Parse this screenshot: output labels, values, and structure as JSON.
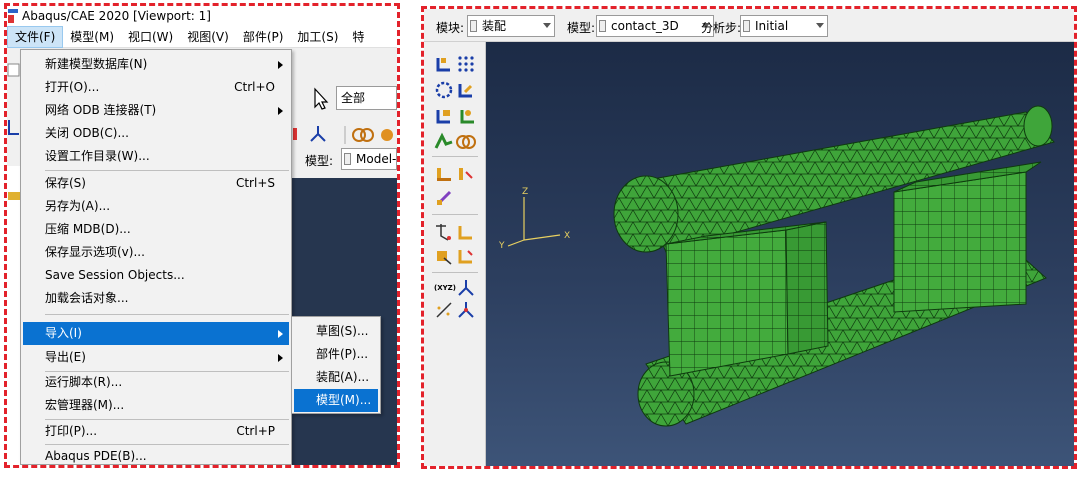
{
  "left": {
    "window_title": "Abaqus/CAE 2020 [Viewport: 1]",
    "menubar": [
      "文件(F)",
      "模型(M)",
      "视口(W)",
      "视图(V)",
      "部件(P)",
      "加工(S)",
      "特"
    ],
    "file_menu": [
      {
        "label": "新建模型数据库(N)",
        "shortcut": "",
        "submenu": true
      },
      {
        "label": "打开(O)...",
        "shortcut": "Ctrl+O",
        "submenu": false
      },
      {
        "label": "网络 ODB 连接器(T)",
        "shortcut": "",
        "submenu": true
      },
      {
        "label": "关闭 ODB(C)...",
        "shortcut": "",
        "submenu": false
      },
      {
        "label": "设置工作目录(W)...",
        "shortcut": "",
        "submenu": false
      },
      {
        "label": "保存(S)",
        "shortcut": "Ctrl+S",
        "submenu": false
      },
      {
        "label": "另存为(A)...",
        "shortcut": "",
        "submenu": false
      },
      {
        "label": "压缩 MDB(D)...",
        "shortcut": "",
        "submenu": false
      },
      {
        "label": "保存显示选项(v)...",
        "shortcut": "",
        "submenu": false
      },
      {
        "label": "Save Session Objects...",
        "shortcut": "",
        "submenu": false
      },
      {
        "label": "加载会话对象...",
        "shortcut": "",
        "submenu": false
      },
      {
        "label": "导入(I)",
        "shortcut": "",
        "submenu": true
      },
      {
        "label": "导出(E)",
        "shortcut": "",
        "submenu": true
      },
      {
        "label": "运行脚本(R)...",
        "shortcut": "",
        "submenu": false
      },
      {
        "label": "宏管理器(M)...",
        "shortcut": "",
        "submenu": false
      },
      {
        "label": "打印(P)...",
        "shortcut": "Ctrl+P",
        "submenu": false
      },
      {
        "label": "Abaqus PDE(B)...",
        "shortcut": "",
        "submenu": false
      }
    ],
    "import_submenu": [
      "草图(S)...",
      "部件(P)...",
      "装配(A)...",
      "模型(M)..."
    ],
    "selection_filter": "全部",
    "model_label": "模型:",
    "model_value": "Model-"
  },
  "right": {
    "module_label": "模块:",
    "module_value": "装配",
    "model_label": "模型:",
    "model_value": "contact_3D",
    "step_label": "分析步:",
    "step_value": "Initial",
    "triad": {
      "x": "X",
      "y": "Y",
      "z": "Z"
    },
    "mesh_color": "#3fa53a"
  }
}
